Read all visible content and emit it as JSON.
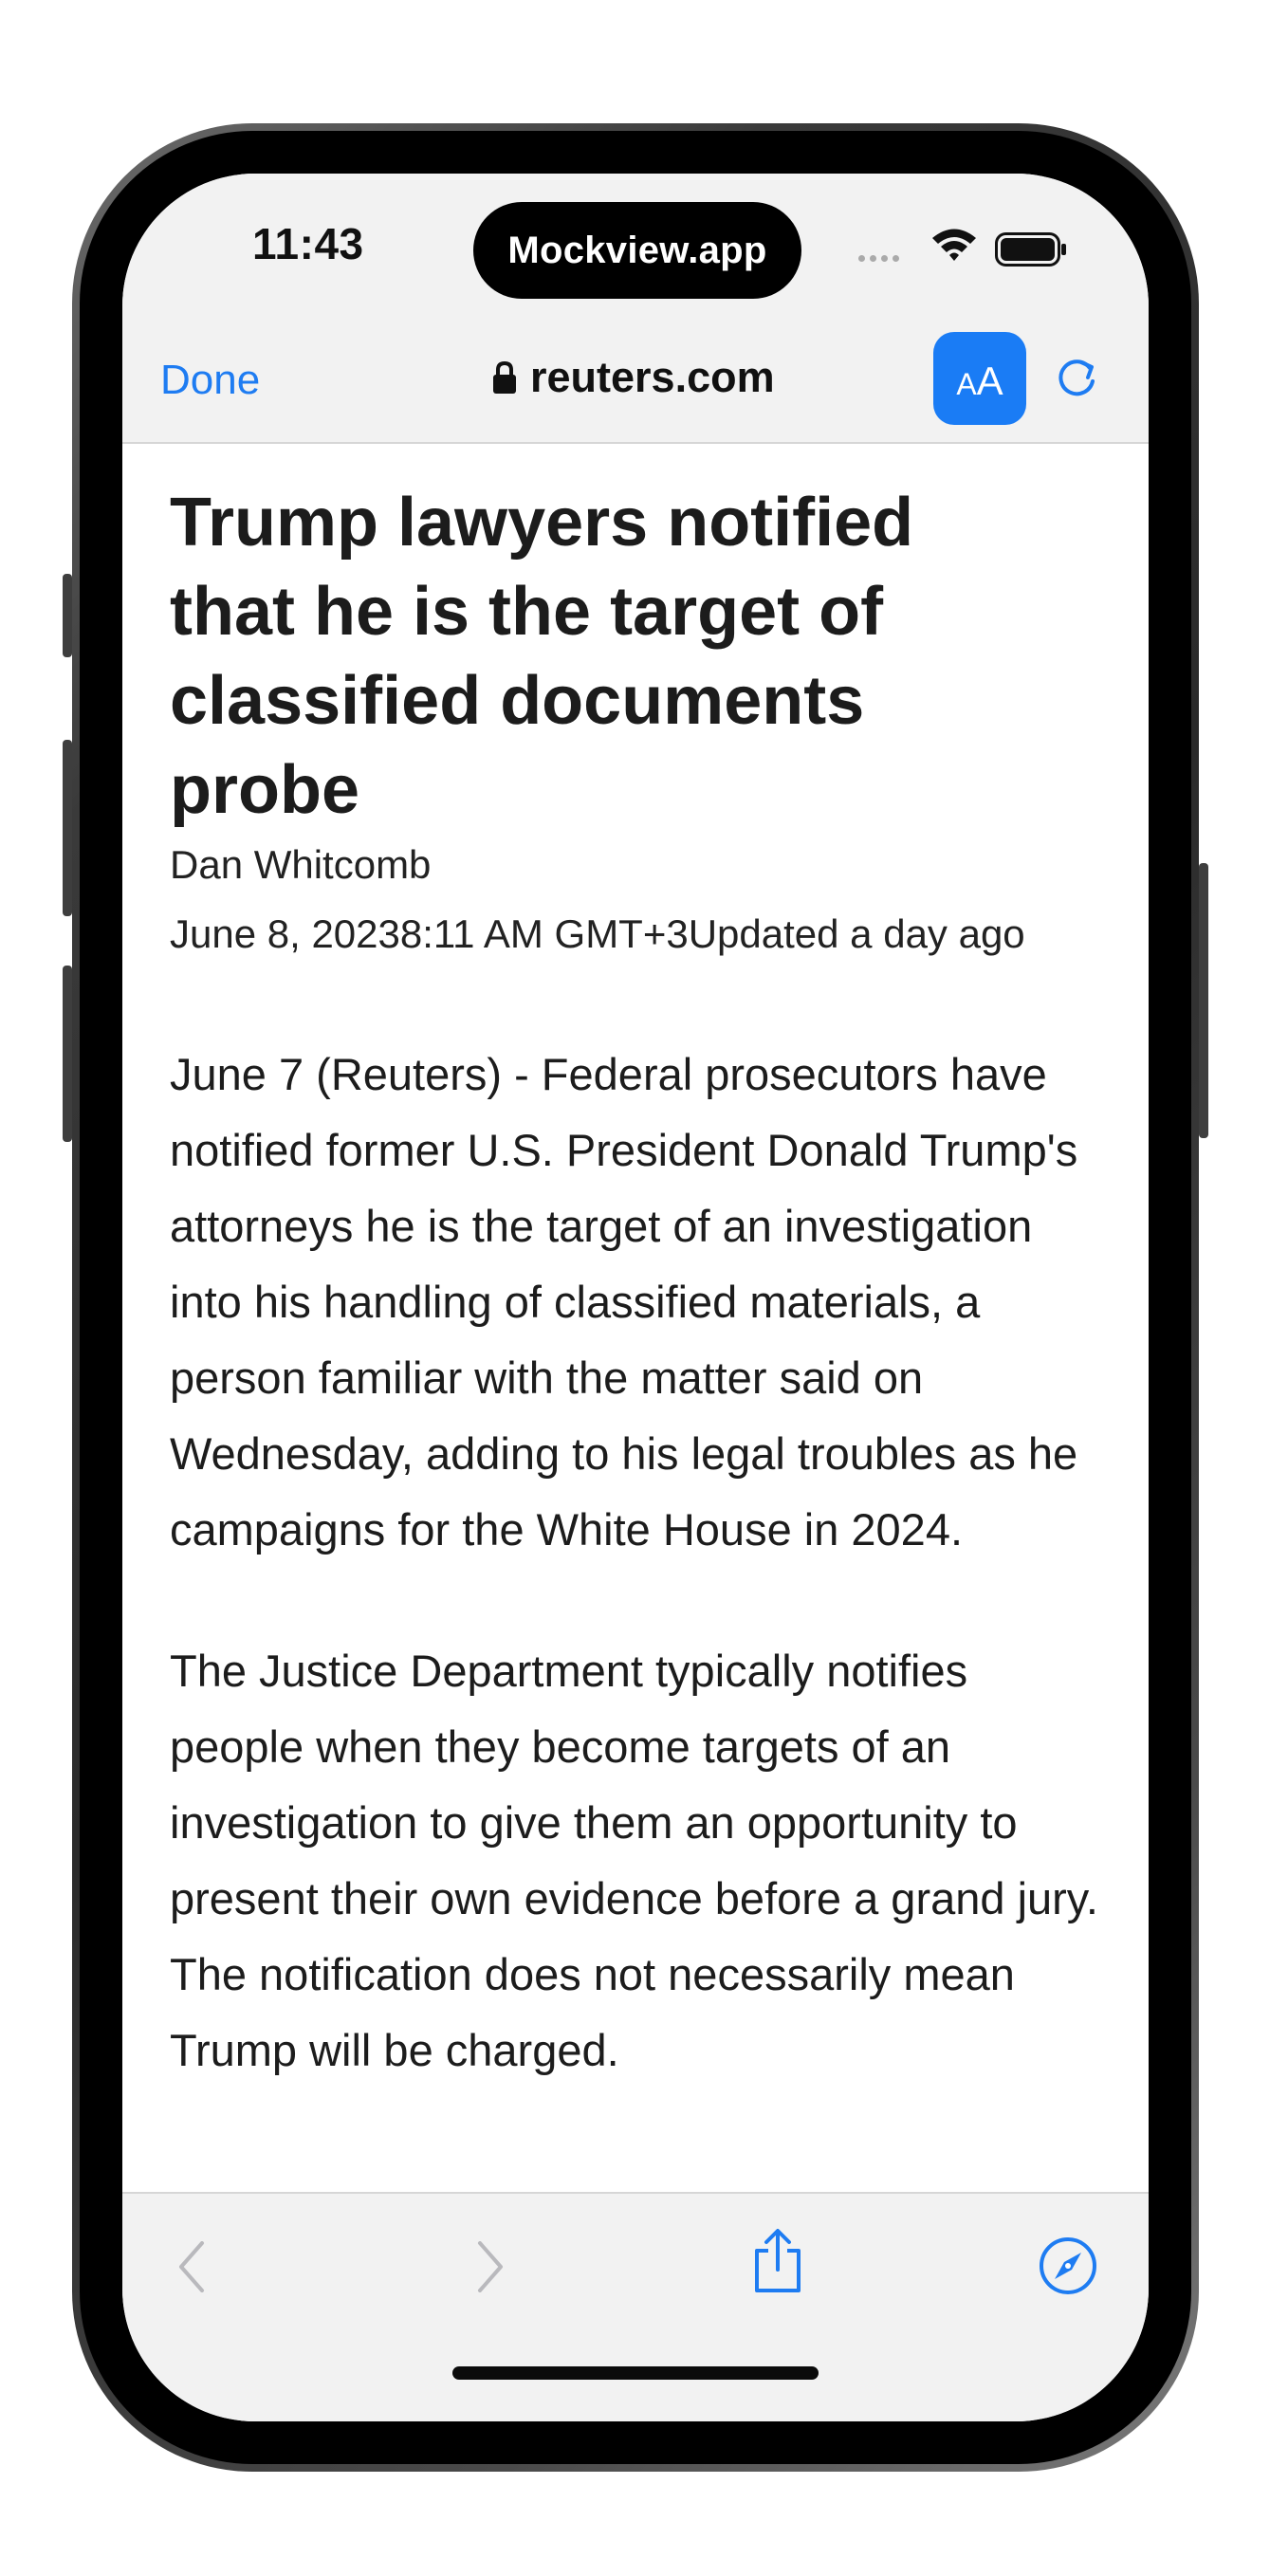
{
  "status_bar": {
    "time": "11:43",
    "island_label": "Mockview.app"
  },
  "browser": {
    "done_label": "Done",
    "url": "reuters.com",
    "reader_small": "A",
    "reader_big": "A"
  },
  "article": {
    "title": "Trump lawyers notified that he is the target of classified documents probe",
    "author": "Dan Whitcomb",
    "dateline": "June 8, 20238:11 AM GMT+3Updated a day ago",
    "paragraphs": [
      "June 7 (Reuters) - Federal prosecutors have notified former U.S. President Donald Trump's attorneys he is the target of an investigation into his handling of classified materials, a person familiar with the matter said on Wednesday, adding to his legal troubles as he campaigns for the White House in 2024.",
      "The Justice Department typically notifies people when they become targets of an investigation to give them an opportunity to present their own evidence before a grand jury. The notification does not necessarily mean Trump will be charged."
    ]
  },
  "colors": {
    "accent": "#1e7cf2",
    "bar_background": "#f2f2f2",
    "disabled_icon": "#b9b9bd"
  },
  "icons": [
    "lock-icon",
    "wifi-icon",
    "battery-icon",
    "reload-icon",
    "back-arrow-icon",
    "forward-arrow-icon",
    "share-icon",
    "compass-icon"
  ]
}
